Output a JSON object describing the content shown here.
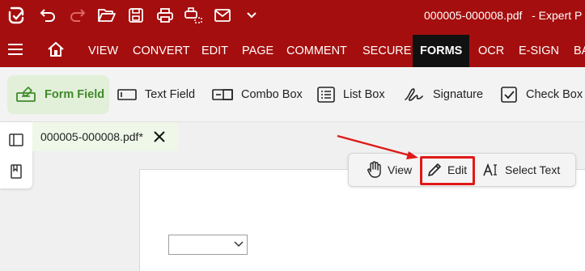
{
  "window": {
    "filename_title": "000005-000008.pdf",
    "app_title": "- Expert P"
  },
  "titlebar_icons": [
    "app-logo-icon",
    "undo-icon",
    "redo-icon",
    "open-folder-icon",
    "save-icon",
    "print-icon",
    "scan-icon",
    "email-icon",
    "chevron-down-icon"
  ],
  "menu": {
    "items": [
      "VIEW",
      "CONVERT",
      "EDIT",
      "PAGE",
      "COMMENT",
      "SECURE",
      "FORMS",
      "OCR",
      "E-SIGN",
      "BA"
    ],
    "active": "FORMS"
  },
  "ribbon": {
    "form_field": "Form Field",
    "text_field": "Text Field",
    "combo_box": "Combo Box",
    "list_box": "List Box",
    "signature": "Signature",
    "check_box": "Check Box"
  },
  "tab": {
    "label": "000005-000008.pdf*"
  },
  "modes": {
    "view": "View",
    "edit": "Edit",
    "select_text": "Select Text"
  },
  "colors": {
    "brand_red": "#a50e0e",
    "active_green": "#3f8a2a",
    "annotation_red": "#e01818"
  }
}
